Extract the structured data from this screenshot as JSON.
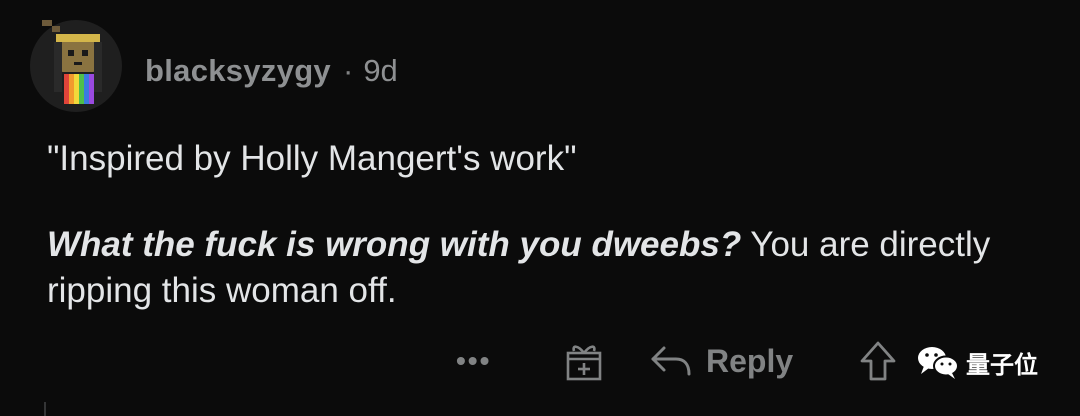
{
  "comment": {
    "username": "blacksyzygy",
    "separator": "·",
    "age": "9d",
    "paragraph1": "\"Inspired by Holly Mangert's work\"",
    "paragraph2_emphasis": "What the fuck is wrong with you dweebs?",
    "paragraph2_rest": " You are directly ripping this woman off."
  },
  "actions": {
    "more_label": "•••",
    "reply_label": "Reply"
  },
  "watermark": {
    "text": "量子位"
  },
  "icons": {
    "avatar": "snoo-avatar-icon",
    "more": "more-options-icon",
    "award": "award-icon",
    "reply": "reply-arrow-icon",
    "upvote": "upvote-arrow-icon",
    "watermark": "wechat-logo-icon"
  },
  "colors": {
    "background": "#0b0b0b",
    "text": "#e3e5e7",
    "muted": "#818384"
  }
}
